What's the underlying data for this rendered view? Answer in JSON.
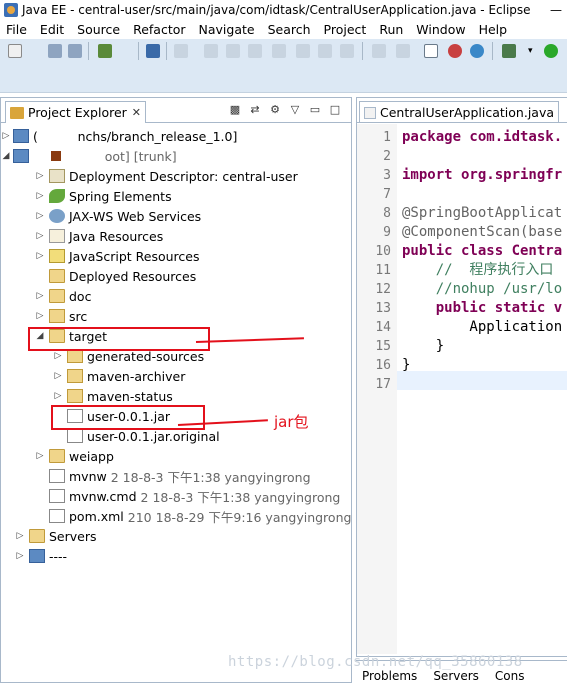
{
  "window": {
    "title": "Java EE - central-user/src/main/java/com/idtask/CentralUserApplication.java - Eclipse"
  },
  "menu": [
    "File",
    "Edit",
    "Source",
    "Refactor",
    "Navigate",
    "Search",
    "Project",
    "Run",
    "Window",
    "Help"
  ],
  "explorer": {
    "tab_label": "Project Explorer",
    "items": [
      {
        "label": "(          nchs/branch_release_1.0]"
      },
      {
        "label": "          oot] [trunk]"
      },
      {
        "label": "Deployment Descriptor: central-user"
      },
      {
        "label": "Spring Elements"
      },
      {
        "label": "JAX-WS Web Services"
      },
      {
        "label": "Java Resources"
      },
      {
        "label": "JavaScript Resources"
      },
      {
        "label": "Deployed Resources"
      },
      {
        "label": "doc"
      },
      {
        "label": "src"
      },
      {
        "label": "target"
      },
      {
        "label": "generated-sources"
      },
      {
        "label": "maven-archiver"
      },
      {
        "label": "maven-status"
      },
      {
        "label": "user-0.0.1.jar"
      },
      {
        "label": "user-0.0.1.jar.original"
      },
      {
        "label": "weiapp"
      },
      {
        "label": "mvnw",
        "meta": "2  18-8-3 下午1:38  yangyingrong"
      },
      {
        "label": "mvnw.cmd",
        "meta": "2  18-8-3 下午1:38  yangyingrong"
      },
      {
        "label": "pom.xml",
        "meta": "210  18-8-29 下午9:16  yangyingrong"
      },
      {
        "label": "Servers"
      },
      {
        "label": "----     "
      }
    ]
  },
  "editor": {
    "tab_label": "CentralUserApplication.java",
    "lines": [
      {
        "n": "1",
        "t": "package com.idtask."
      },
      {
        "n": "2",
        "t": ""
      },
      {
        "n": "3",
        "t": "import org.springfr"
      },
      {
        "n": "7",
        "t": ""
      },
      {
        "n": "8",
        "t": "@SpringBootApplicat"
      },
      {
        "n": "9",
        "t": "@ComponentScan(base"
      },
      {
        "n": "10",
        "t": "public class Centra"
      },
      {
        "n": "11",
        "t": "    //  程序执行入口"
      },
      {
        "n": "12",
        "t": "    //nohup /usr/lo"
      },
      {
        "n": "13",
        "t": "    public static v"
      },
      {
        "n": "14",
        "t": "        Application"
      },
      {
        "n": "15",
        "t": "    }"
      },
      {
        "n": "16",
        "t": "}"
      },
      {
        "n": "17",
        "t": ""
      }
    ]
  },
  "bottom_tabs": [
    "Problems",
    "Servers",
    "Cons"
  ],
  "annotation": {
    "jar_label": "jar包"
  },
  "watermark": "https://blog.csdn.net/qq_35860138",
  "colors": {
    "annotation_red": "#e3101b",
    "toolbar_bg": "#dce8f4"
  }
}
